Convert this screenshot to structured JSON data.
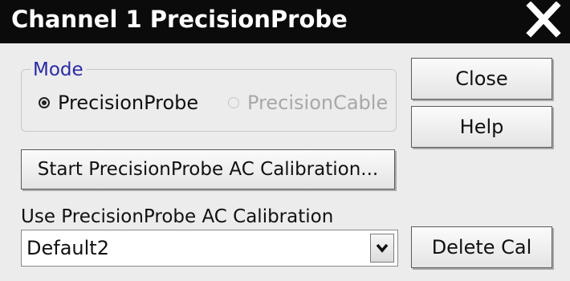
{
  "window": {
    "title": "Channel 1 PrecisionProbe",
    "close_icon": "close-x-icon"
  },
  "mode": {
    "label": "Mode",
    "options": [
      "PrecisionProbe",
      "PrecisionCable"
    ],
    "selected": "PrecisionProbe",
    "disabled": [
      "PrecisionCable"
    ]
  },
  "buttons": {
    "close": "Close",
    "help": "Help",
    "start_calibration": "Start PrecisionProbe AC Calibration...",
    "delete_cal": "Delete Cal"
  },
  "calibration": {
    "label": "Use PrecisionProbe AC Calibration",
    "selected": "Default2",
    "dropdown_icon": "chevron-down-icon"
  },
  "colors": {
    "titlebar": "#0b0b0b",
    "title_text": "#ffffff",
    "window_bg": "#ececec",
    "group_label": "#2a2aa8",
    "disabled_text": "#a8a8a8"
  }
}
